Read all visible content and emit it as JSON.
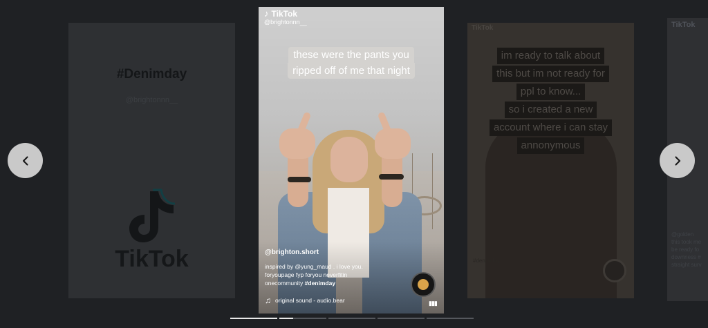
{
  "left_card": {
    "hashtag": "#Denimday",
    "handle": "@brightonnn__",
    "logo_text": "TikTok"
  },
  "right_card": {
    "watermark": "TikTok",
    "caption_lines": [
      "im ready to talk about",
      "this but im not ready for",
      "ppl to know...",
      "so i created a new",
      "account where i can stay",
      "annonymous"
    ],
    "hashtag": "#denimday"
  },
  "far_right_card": {
    "watermark": "TikTok",
    "handle": "@golden",
    "snippets": [
      "this took me",
      "be ready fo",
      "downness #",
      "straight surv"
    ]
  },
  "video": {
    "watermark": "TikTok",
    "watermark_handle": "@brightonnn__",
    "caption_lines": [
      "these were the pants you",
      "ripped off of me that night"
    ],
    "author": "@brighton.short",
    "description_lines": [
      "inspired by @yung_maud . i love you.",
      "foryoupage fyp foryou neverfitin"
    ],
    "description_tail": "onecommunity",
    "description_hashtag": "#denimday",
    "sound": "original sound - audio.bear",
    "icons": {
      "music": "music-note-icon",
      "disc": "spinning-disc-icon",
      "bars": "audio-bars-icon",
      "logo": "tiktok-logo-icon"
    }
  },
  "nav": {
    "prev_icon": "chevron-left-icon",
    "next_icon": "chevron-right-icon"
  },
  "progress": {
    "segments": 5,
    "completed": 1,
    "current_fraction": 0.3
  },
  "colors": {
    "background": "#1f2124",
    "nav_button": "#c9c9c9",
    "progress_fill": "#e9e9e9",
    "progress_track": "#55585d"
  }
}
